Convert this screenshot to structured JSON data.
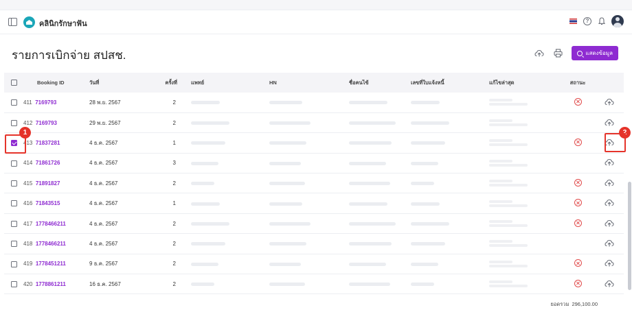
{
  "app": {
    "name": "คลินิกรักษาฟัน"
  },
  "page": {
    "title": "รายการเบิกจ่าย สปสช.",
    "search_label": "แสดงข้อมูล"
  },
  "table": {
    "columns": [
      "",
      "Booking ID",
      "วันที่",
      "ครั้งที่",
      "แพทย์",
      "HN",
      "ชื่อคนไข้",
      "เลขที่ใบแจ้งหนี้",
      "แก้ไขล่าสุด",
      "สถานะ",
      ""
    ],
    "rows": [
      {
        "no": "411",
        "booking_id": "7169793",
        "date": "28 พ.ย. 2567",
        "visit": "2",
        "checked": false,
        "status": "rejected"
      },
      {
        "no": "412",
        "booking_id": "7169793",
        "date": "29 พ.ย. 2567",
        "visit": "2",
        "checked": false,
        "status": ""
      },
      {
        "no": "413",
        "booking_id": "71837281",
        "date": "4 ธ.ค. 2567",
        "visit": "1",
        "checked": true,
        "status": "rejected"
      },
      {
        "no": "414",
        "booking_id": "71861726",
        "date": "4 ธ.ค. 2567",
        "visit": "3",
        "checked": false,
        "status": ""
      },
      {
        "no": "415",
        "booking_id": "71891827",
        "date": "4 ธ.ค. 2567",
        "visit": "2",
        "checked": false,
        "status": "rejected"
      },
      {
        "no": "416",
        "booking_id": "71843515",
        "date": "4 ธ.ค. 2567",
        "visit": "1",
        "checked": false,
        "status": "rejected"
      },
      {
        "no": "417",
        "booking_id": "1778466211",
        "date": "4 ธ.ค. 2567",
        "visit": "2",
        "checked": false,
        "status": "rejected"
      },
      {
        "no": "418",
        "booking_id": "1778466211",
        "date": "4 ธ.ค. 2567",
        "visit": "2",
        "checked": false,
        "status": ""
      },
      {
        "no": "419",
        "booking_id": "1778451211",
        "date": "9 ธ.ค. 2567",
        "visit": "2",
        "checked": false,
        "status": "rejected"
      },
      {
        "no": "420",
        "booking_id": "1778861211",
        "date": "16 ธ.ค. 2567",
        "visit": "2",
        "checked": false,
        "status": "rejected"
      }
    ]
  },
  "annotations": [
    {
      "label": "1"
    },
    {
      "label": "2"
    }
  ],
  "footer": {
    "total_label": "ยอดรวม",
    "total_value": "296,100.00"
  },
  "colors": {
    "accent": "#8e2bd1",
    "danger": "#e14b4b",
    "marker": "#e5332a"
  },
  "icons": [
    "sidebar-toggle-icon",
    "clinic-logo-icon",
    "thai-flag-icon",
    "help-icon",
    "bell-icon",
    "user-avatar-icon",
    "upload-icon",
    "print-icon",
    "search-icon",
    "reject-icon",
    "checkbox-icon"
  ]
}
